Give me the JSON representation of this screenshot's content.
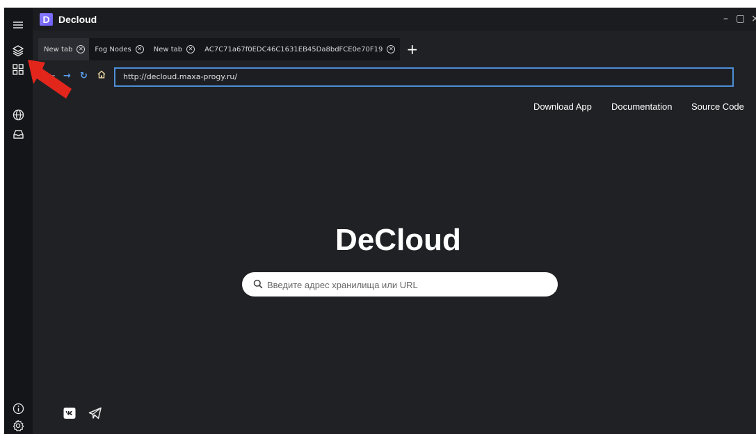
{
  "app": {
    "logo_letter": "D",
    "title": "Decloud",
    "window_controls": {
      "minimize": "–",
      "maximize": "▢",
      "close": "×"
    }
  },
  "sidebar": {
    "icons": [
      "menu-icon",
      "layers-icon",
      "grid-icon",
      "globe-icon",
      "inbox-icon",
      "info-icon",
      "settings-icon"
    ]
  },
  "tabs": [
    {
      "label": "New tab",
      "active": true
    },
    {
      "label": "Fog Nodes",
      "active": false
    },
    {
      "label": "New tab",
      "active": false
    },
    {
      "label": "AC7C71a67f0EDC46C1631EB45Da8bdFCE0e70F19",
      "active": false
    }
  ],
  "tab_add": "+",
  "nav": {
    "url": "http://decloud.maxa-progy.ru/"
  },
  "top_links": [
    "Download App",
    "Documentation",
    "Source Code"
  ],
  "brand": "DeCloud",
  "search": {
    "placeholder": "Введите адрес хранилища или URL",
    "value": ""
  },
  "social": [
    "vk-icon",
    "telegram-icon"
  ],
  "colors": {
    "sidebar": "#141519",
    "content": "#202125",
    "accent": "#4c8fd6",
    "arrow": "#e3261c"
  }
}
